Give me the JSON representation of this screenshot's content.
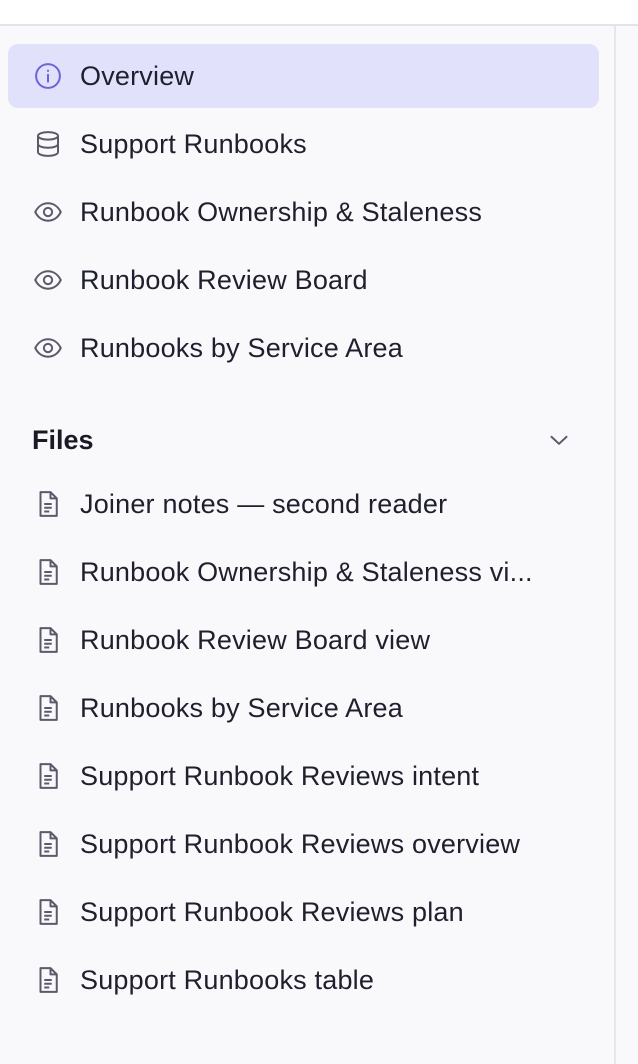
{
  "colors": {
    "active_bg": "#e1e1fb",
    "active_icon": "#6b63d9",
    "icon": "#5a5a6a"
  },
  "nav": [
    {
      "label": "Overview",
      "icon": "info-icon",
      "active": true
    },
    {
      "label": "Support Runbooks",
      "icon": "database-icon"
    },
    {
      "label": "Runbook Ownership & Staleness",
      "icon": "eye-icon"
    },
    {
      "label": "Runbook Review Board",
      "icon": "eye-icon"
    },
    {
      "label": "Runbooks by Service Area",
      "icon": "eye-icon"
    }
  ],
  "files": {
    "title": "Files",
    "items": [
      {
        "label": "Joiner notes — second reader",
        "icon": "document-icon"
      },
      {
        "label": "Runbook Ownership & Staleness vi...",
        "icon": "document-icon"
      },
      {
        "label": "Runbook Review Board view",
        "icon": "document-icon"
      },
      {
        "label": "Runbooks by Service Area",
        "icon": "document-icon"
      },
      {
        "label": "Support Runbook Reviews intent",
        "icon": "document-icon"
      },
      {
        "label": "Support Runbook Reviews overview",
        "icon": "document-icon"
      },
      {
        "label": "Support Runbook Reviews plan",
        "icon": "document-icon"
      },
      {
        "label": "Support Runbooks table",
        "icon": "document-icon"
      }
    ]
  }
}
